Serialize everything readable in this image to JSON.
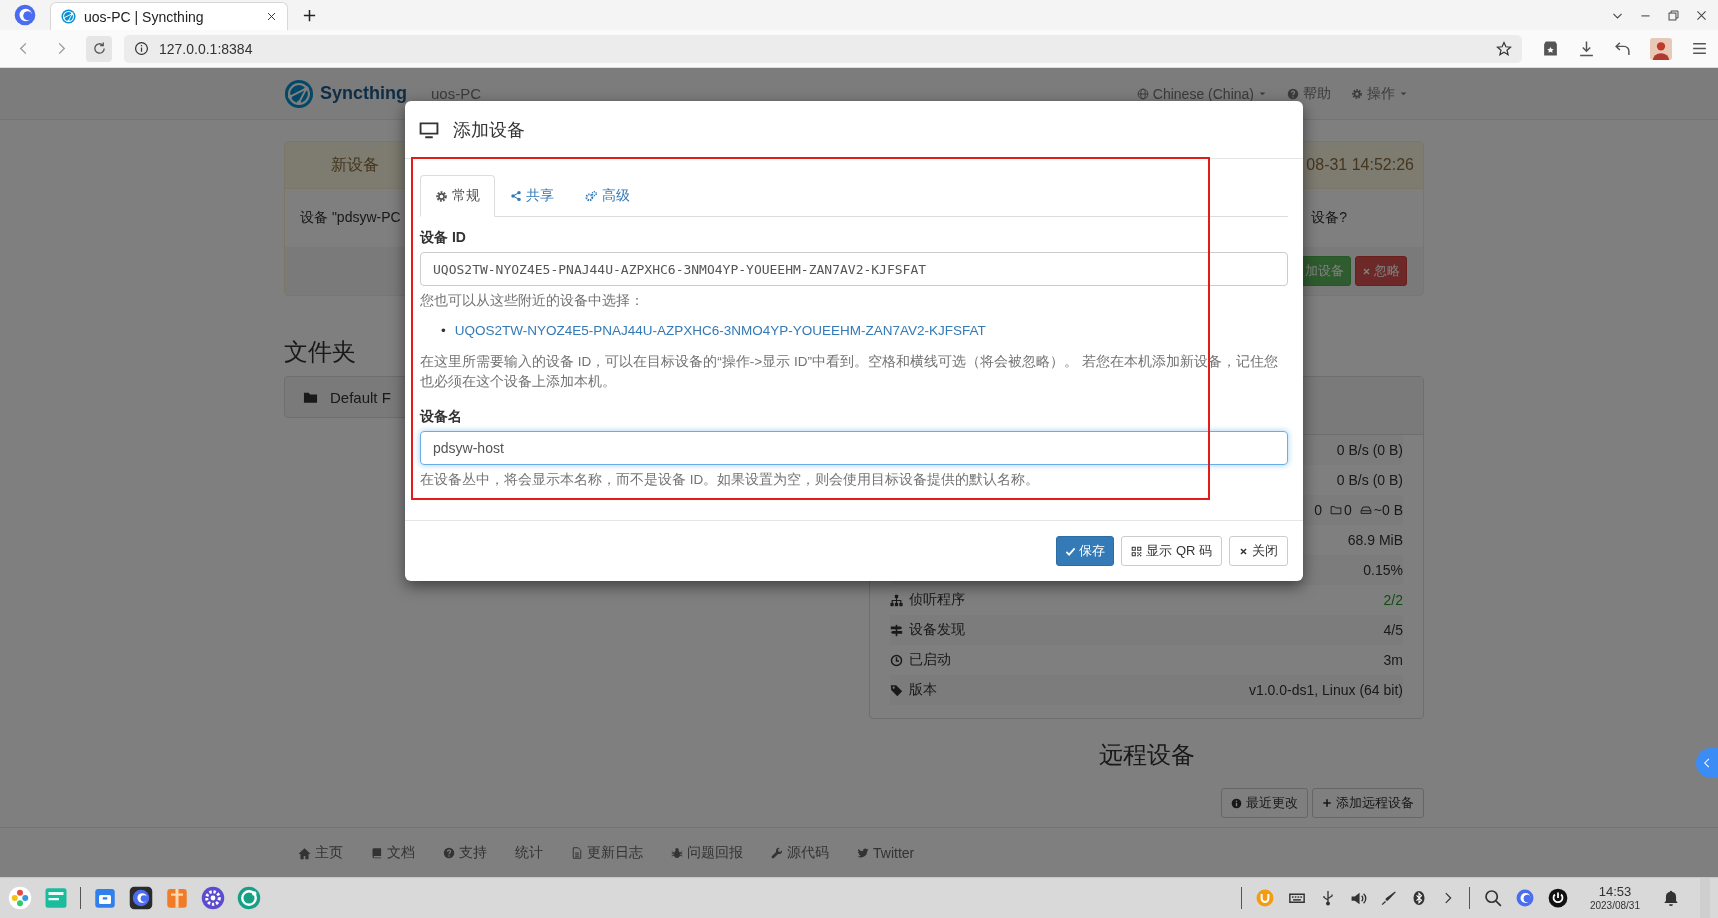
{
  "browser": {
    "tab_title": "uos-PC | Syncthing",
    "address": "127.0.0.1:8384"
  },
  "navbar": {
    "brand": "Syncthing",
    "device_name": "uos-PC",
    "menus": [
      "Chinese (China)",
      "帮助",
      "操作"
    ]
  },
  "new_device": {
    "title": "新设备",
    "time": "08-31 14:52:26",
    "message_start": "设备 \"pdsyw-PC",
    "message_end": "设备?",
    "buttons": [
      "加设备",
      "忽略"
    ]
  },
  "folders": {
    "heading": "文件夹",
    "items": [
      "Default F"
    ]
  },
  "this_device": {
    "rows": [
      {
        "kind": "value",
        "value": "0 B/s (0 B)",
        "highlighted": false
      },
      {
        "kind": "value",
        "value": "0 B/s (0 B)",
        "highlighted": false
      },
      {
        "kind": "counts",
        "values": [
          "0",
          "0",
          "~0 B"
        ],
        "highlighted": false
      },
      {
        "kind": "value",
        "value": "68.9 MiB",
        "highlighted": false
      },
      {
        "kind": "value",
        "value": "0.15%",
        "highlighted": false
      },
      {
        "kind": "labeled",
        "label": "侦听程序",
        "value": "2/2",
        "highlighted": true
      },
      {
        "kind": "labeled",
        "label": "设备发现",
        "value": "4/5",
        "highlighted": false
      },
      {
        "kind": "labeled",
        "label": "已启动",
        "value": "3m",
        "highlighted": false
      },
      {
        "kind": "labeled",
        "label": "版本",
        "value": "v1.0.0-ds1, Linux (64 bit)",
        "highlighted": false
      }
    ]
  },
  "remote_devices": {
    "heading": "远程设备",
    "buttons": [
      "最近更改",
      "添加远程设备"
    ]
  },
  "footer": {
    "links": [
      "主页",
      "文档",
      "支持",
      "统计",
      "更新日志",
      "问题回报",
      "源代码",
      "Twitter"
    ]
  },
  "modal": {
    "title": "添加设备",
    "tabs": [
      {
        "label": "常规",
        "selected": true
      },
      {
        "label": "共享",
        "selected": false
      },
      {
        "label": "高级",
        "selected": false
      }
    ],
    "device_id": {
      "label": "设备 ID",
      "value": "UQOS2TW-NYOZ4E5-PNAJ44U-AZPXHC6-3NMO4YP-YOUEEHM-ZAN7AV2-KJFSFAT"
    },
    "nearby_hint": "您也可以从这些附近的设备中选择：",
    "nearby": [
      {
        "marker": "•",
        "id": "UQOS2TW-NYOZ4E5-PNAJ44U-AZPXHC6-3NMO4YP-YOUEEHM-ZAN7AV2-KJFSFAT"
      }
    ],
    "id_help": "在这里所需要输入的设备 ID，可以在目标设备的“操作->显示 ID”中看到。空格和横线可选（将会被忽略）。 若您在本机添加新设备，记住您也必须在这个设备上添加本机。",
    "device_name": {
      "label": "设备名",
      "value": "pdsyw-host",
      "focused": true
    },
    "name_help": "在设备丛中，将会显示本名称，而不是设备 ID。如果设置为空，则会使用目标设备提供的默认名称。",
    "buttons": [
      "保存",
      "显示 QR 码",
      "关闭"
    ]
  },
  "taskbar": {
    "time": "14:53",
    "date": "2023/08/31"
  }
}
